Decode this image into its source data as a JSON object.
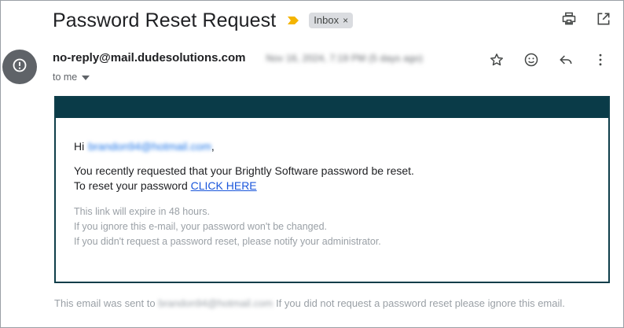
{
  "subject": "Password Reset Request",
  "label": {
    "name": "Inbox",
    "close": "×"
  },
  "sender": {
    "email": "no-reply@mail.dudesolutions.com",
    "date": "Nov 16, 2024, 7:19 PM (5 days ago)",
    "recipient_summary": "to me"
  },
  "body": {
    "greeting_prefix": "Hi",
    "greeting_email": "brandon94@hotmail.com",
    "greeting_suffix": ",",
    "line1": "You recently requested that your Brightly Software password be reset.",
    "line2_prefix": "To reset your password",
    "link_text": "CLICK HERE",
    "fine1": "This link will expire in 48 hours.",
    "fine2": "If you ignore this e-mail, your password won't be changed.",
    "fine3": "If you didn't request a password reset, please notify your administrator."
  },
  "footer": {
    "prefix": "This email was sent to",
    "email": "brandon94@hotmail.com",
    "suffix": "If you did not request a password reset please ignore this email."
  },
  "colors": {
    "header_band": "#0a3b48",
    "card_border": "#0f3e4a",
    "importance": "#f4b400",
    "link": "#1a56db"
  },
  "icons": {
    "print": "print-icon",
    "open_new_window": "open-in-new-icon",
    "star": "star-icon",
    "emoji": "emoji-icon",
    "reply": "reply-icon",
    "more": "more-vert-icon",
    "avatar": "alert-circle-icon"
  }
}
